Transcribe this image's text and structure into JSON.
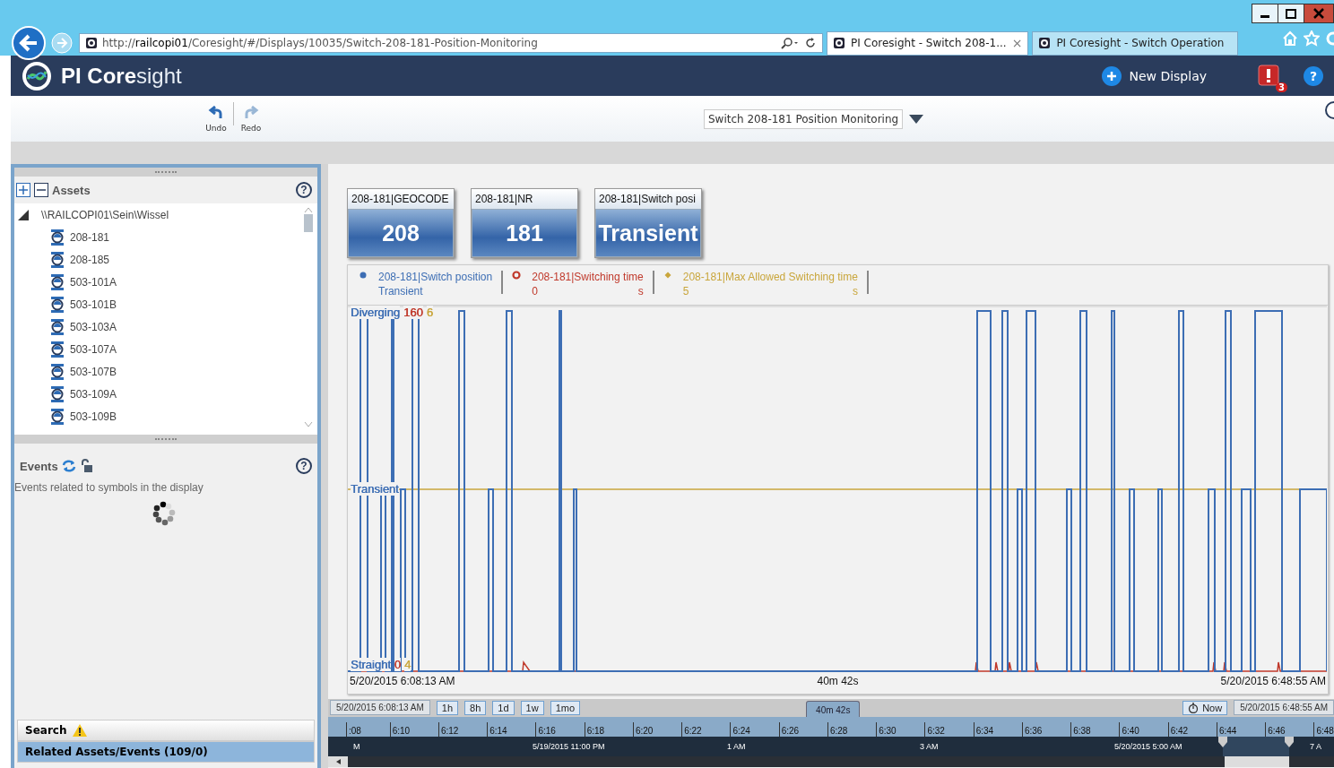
{
  "browser": {
    "address": "http://**railcopi01**/Coresight/#/Displays/10035/Switch-208-181-Position-Monitoring",
    "tabs": [
      {
        "title": "PI Coresight - Switch 208-1...",
        "selected": true,
        "close": "×"
      },
      {
        "title": "PI Coresight - Switch Operation",
        "selected": false
      }
    ]
  },
  "header": {
    "title": "**PI Core**sight",
    "new_display": "New Display",
    "alert_count": "3",
    "help": "?"
  },
  "toolbar": {
    "undo": {
      "label": "Undo",
      "disabled": false
    },
    "redo": {
      "label": "Redo",
      "disabled": true
    },
    "display_name": "Switch 208-181 Position Monitoring"
  },
  "assets": {
    "title": "Assets",
    "help": "?",
    "root": {
      "label": "\\\\RAILCOPI01\\Sein\\Wissel",
      "expanded": true,
      "children": [
        {
          "label": "208-181"
        },
        {
          "label": "208-185"
        },
        {
          "label": "503-101A"
        },
        {
          "label": "503-101B"
        },
        {
          "label": "503-103A"
        },
        {
          "label": "503-107A"
        },
        {
          "label": "503-107B"
        },
        {
          "label": "503-109A"
        },
        {
          "label": "503-109B"
        }
      ]
    }
  },
  "events": {
    "title": "Events",
    "help": "?",
    "description": "Events related to symbols in the display"
  },
  "search": {
    "label": "Search"
  },
  "related": {
    "label": "Related Assets/Events (109/0)"
  },
  "tiles": [
    {
      "label": "208-181|GEOCODE",
      "value": "208"
    },
    {
      "label": "208-181|NR",
      "value": "181"
    },
    {
      "label": "208-181|Switch posi",
      "value": "Transient"
    }
  ],
  "trend": {
    "legend": [
      {
        "kind": "dot",
        "name": "208-181|Switch position",
        "value": "Transient",
        "color": "#3d6eb4"
      },
      {
        "kind": "ring",
        "name": "208-181|Switching time",
        "value": "0",
        "unit": "s",
        "color": "#c0392b"
      },
      {
        "kind": "diamond",
        "name": "208-181|Max Allowed Switching time",
        "value": "5",
        "unit": "s",
        "color": "#c9a63c"
      }
    ],
    "top_labels": [
      {
        "text": "Diverging",
        "color": "#3d6eb4"
      },
      {
        "text": "160",
        "color": "#c0392b"
      },
      {
        "text": "6",
        "color": "#c9a63c"
      }
    ],
    "mid_labels": [
      {
        "text": "Transient",
        "color": "#3d6eb4"
      }
    ],
    "bottom_labels": [
      {
        "text": "Straight",
        "color": "#3d6eb4"
      },
      {
        "text": "0",
        "color": "#c0392b"
      },
      {
        "text": "4",
        "color": "#c9a63c"
      }
    ],
    "start": "5/20/2015 6:08:13 AM",
    "duration": "40m 42s",
    "end": "5/20/2015 6:48:55 AM"
  },
  "timebar": {
    "start": "5/20/2015 6:08:13 AM",
    "ranges": [
      "1h",
      "8h",
      "1d",
      "1w",
      "1mo"
    ],
    "duration": "40m 42s",
    "now": "Now",
    "end": "5/20/2015 6:48:55 AM",
    "ticks": [
      ":08",
      "6:10",
      "6:12",
      "6:14",
      "6:16",
      "6:18",
      "6:20",
      "6:22",
      "6:24",
      "6:26",
      "6:28",
      "6:30",
      "6:32",
      "6:34",
      "6:36",
      "6:38",
      "6:40",
      "6:42",
      "6:44",
      "6:46",
      "6:48"
    ],
    "overview": [
      "M",
      "5/19/2015 11:00 PM",
      "1 AM",
      "3 AM",
      "5/20/2015 5:00 AM",
      "7 A"
    ]
  }
}
